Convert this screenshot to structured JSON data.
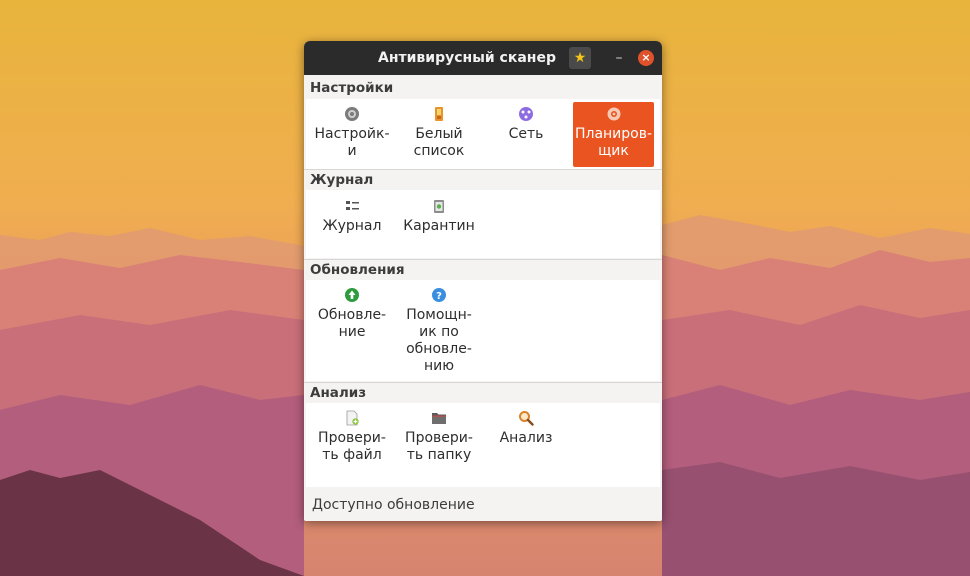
{
  "window": {
    "title": "Антивирусный сканер",
    "pin_icon": "star-icon",
    "minimize_label": "–",
    "close_label": "×"
  },
  "sections": [
    {
      "header": "Настройки",
      "items": [
        {
          "label_1": "Настройк-",
          "label_2": "и",
          "icon": "gear-icon",
          "active": false
        },
        {
          "label_1": "Белый",
          "label_2": "список",
          "icon": "whitelist-icon",
          "active": false
        },
        {
          "label_1": "Сеть",
          "label_2": "",
          "icon": "network-icon",
          "active": false
        },
        {
          "label_1": "Планиров-",
          "label_2": "щик",
          "icon": "scheduler-gear-icon",
          "active": true
        }
      ]
    },
    {
      "header": "Журнал",
      "items": [
        {
          "label_1": "Журнал",
          "icon": "list-icon"
        },
        {
          "label_1": "Карантин",
          "icon": "quarantine-icon"
        }
      ]
    },
    {
      "header": "Обновления",
      "items": [
        {
          "label_1": "Обновле-",
          "label_2": "ние",
          "icon": "update-arrow-icon"
        },
        {
          "label_1": "Помощн-",
          "label_2": "ик по",
          "label_3": "обновле-",
          "label_4": "нию",
          "icon": "help-icon"
        }
      ]
    },
    {
      "header": "Анализ",
      "items": [
        {
          "label_1": "Провери-",
          "label_2": "ть файл",
          "icon": "file-add-icon"
        },
        {
          "label_1": "Провери-",
          "label_2": "ть папку",
          "icon": "folder-icon"
        },
        {
          "label_1": "Анализ",
          "icon": "magnifier-icon"
        }
      ]
    }
  ],
  "status_bar": {
    "text": "Доступно обновление"
  },
  "colors": {
    "accent": "#e95420",
    "titlebar": "#2b2b2b",
    "window_bg": "#f4f3f2",
    "close_button": "#e0522b"
  }
}
